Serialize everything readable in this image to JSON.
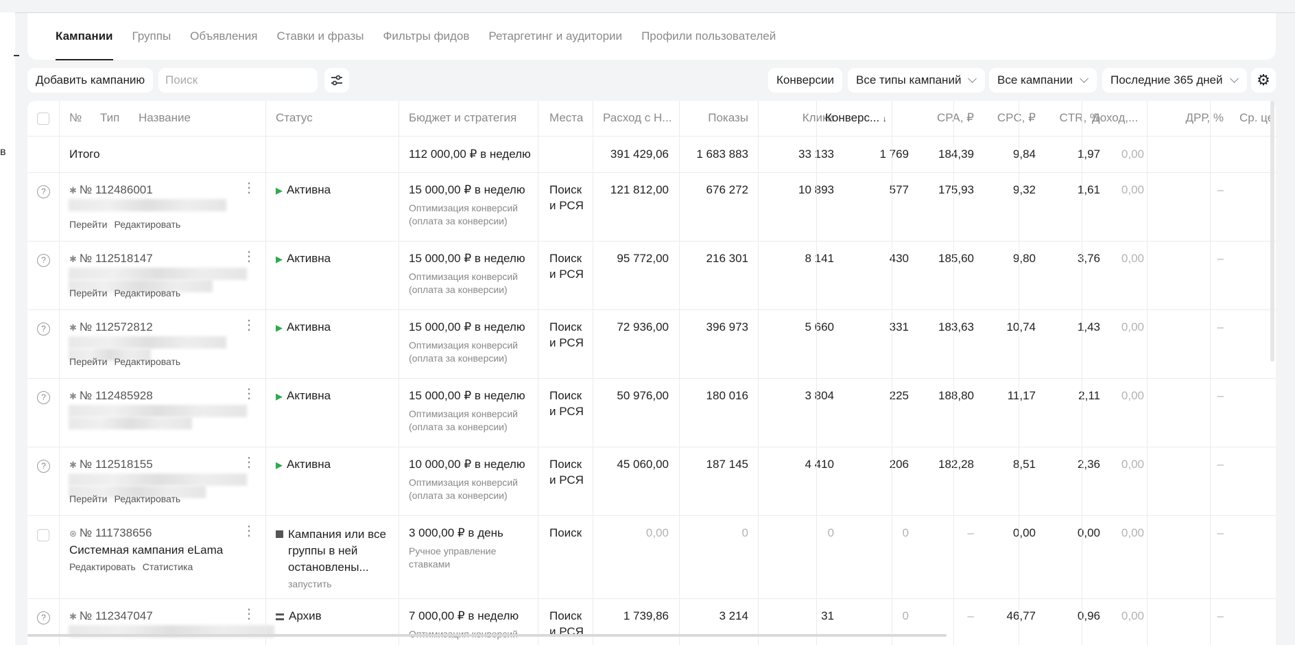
{
  "tabs": [
    "Кампании",
    "Группы",
    "Объявления",
    "Ставки и фразы",
    "Фильтры фидов",
    "Ретаргетинг и аудитории",
    "Профили пользователей"
  ],
  "toolbar": {
    "add_label": "Добавить кампанию",
    "search_placeholder": "Поиск",
    "conversions_label": "Конверсии",
    "types_label": "Все типы кампаний",
    "campaigns_label": "Все кампании",
    "period_label": "Последние 365 дней"
  },
  "gutter_char": "в",
  "columns": {
    "num": "№",
    "type": "Тип",
    "name": "Название",
    "status": "Статус",
    "budget": "Бюджет и стратегия",
    "places": "Места",
    "spend": "Расход с Н...",
    "impressions": "Показы",
    "clicks": "Клики",
    "conversions": "Конверс...",
    "cpa": "CPA, ₽",
    "cpc": "CPC, ₽",
    "ctr": "CTR, %",
    "income": "Доход,...",
    "drr": "ДРР, %",
    "avg": "Ср. це"
  },
  "total": {
    "label": "Итого",
    "budget": "112 000,00 ₽ в неделю",
    "spend": "391 429,06",
    "impressions": "1 683 883",
    "clicks": "33 133",
    "conversions": "1 769",
    "cpa": "184,39",
    "cpc": "9,84",
    "ctr": "1,97",
    "income": "0,00"
  },
  "rows": [
    {
      "num": "№ 112486001",
      "name": "",
      "links": [
        "Перейти",
        "Редактировать"
      ],
      "status": "Активна",
      "budget": "15 000,00 ₽ в неделю",
      "strategy": [
        "Оптимизация конверсий",
        "(оплата за конверсии)"
      ],
      "places": [
        "Поиск",
        "и РСЯ"
      ],
      "spend": "121 812,00",
      "impressions": "676 272",
      "clicks": "10 893",
      "conversions": "577",
      "cpa": "175,93",
      "cpc": "9,32",
      "ctr": "1,61",
      "income": "0,00",
      "drr": "–"
    },
    {
      "num": "№ 112518147",
      "name": "",
      "links": [
        "Перейти",
        "Редактировать"
      ],
      "status": "Активна",
      "budget": "15 000,00 ₽ в неделю",
      "strategy": [
        "Оптимизация конверсий",
        "(оплата за конверсии)"
      ],
      "places": [
        "Поиск",
        "и РСЯ"
      ],
      "spend": "95 772,00",
      "impressions": "216 301",
      "clicks": "8 141",
      "conversions": "430",
      "cpa": "185,60",
      "cpc": "9,80",
      "ctr": "3,76",
      "income": "0,00",
      "drr": "–"
    },
    {
      "num": "№ 112572812",
      "name": "",
      "links": [
        "Перейти",
        "Редактировать"
      ],
      "status": "Активна",
      "budget": "15 000,00 ₽ в неделю",
      "strategy": [
        "Оптимизация конверсий",
        "(оплата за конверсии)"
      ],
      "places": [
        "Поиск",
        "и РСЯ"
      ],
      "spend": "72 936,00",
      "impressions": "396 973",
      "clicks": "5 660",
      "conversions": "331",
      "cpa": "183,63",
      "cpc": "10,74",
      "ctr": "1,43",
      "income": "0,00",
      "drr": "–"
    },
    {
      "num": "№ 112485928",
      "name": "",
      "links": [],
      "status": "Активна",
      "budget": "15 000,00 ₽ в неделю",
      "strategy": [
        "Оптимизация конверсий",
        "(оплата за конверсии)"
      ],
      "places": [
        "Поиск",
        "и РСЯ"
      ],
      "spend": "50 976,00",
      "impressions": "180 016",
      "clicks": "3 804",
      "conversions": "225",
      "cpa": "188,80",
      "cpc": "11,17",
      "ctr": "2,11",
      "income": "0,00",
      "drr": "–"
    },
    {
      "num": "№ 112518155",
      "name": "",
      "links": [
        "Перейти",
        "Редактировать"
      ],
      "status": "Активна",
      "budget": "10 000,00 ₽ в неделю",
      "strategy": [
        "Оптимизация конверсий",
        "(оплата за конверсии)"
      ],
      "places": [
        "Поиск",
        "и РСЯ"
      ],
      "spend": "45 060,00",
      "impressions": "187 145",
      "clicks": "4 410",
      "conversions": "206",
      "cpa": "182,28",
      "cpc": "8,51",
      "ctr": "2,36",
      "income": "0,00",
      "drr": "–"
    },
    {
      "num": "№ 111738656",
      "name": "Системная кампания eLama",
      "links": [
        "Редактировать",
        "Статистика"
      ],
      "status_lines": [
        "Кампания или все",
        "группы в ней",
        "остановлены..."
      ],
      "status_action": "запустить",
      "budget": "3 000,00 ₽ в день",
      "strategy": [
        "Ручное управление",
        "ставками"
      ],
      "places": [
        "Поиск"
      ],
      "spend": "0,00",
      "impressions": "0",
      "clicks": "0",
      "conversions": "0",
      "cpa": "–",
      "cpc": "0,00",
      "ctr": "0,00",
      "income": "0,00",
      "drr": "–"
    },
    {
      "num": "№ 112347047",
      "name": "",
      "links": [],
      "status": "Архив",
      "budget": "7 000,00 ₽ в неделю",
      "strategy": [
        "Оптимизация конверсий"
      ],
      "places": [
        "Поиск",
        "и РСЯ"
      ],
      "spend": "1 739,86",
      "impressions": "3 214",
      "clicks": "31",
      "conversions": "0",
      "cpa": "–",
      "cpc": "46,77",
      "ctr": "0,96",
      "income": "0,00",
      "drr": "–"
    }
  ]
}
